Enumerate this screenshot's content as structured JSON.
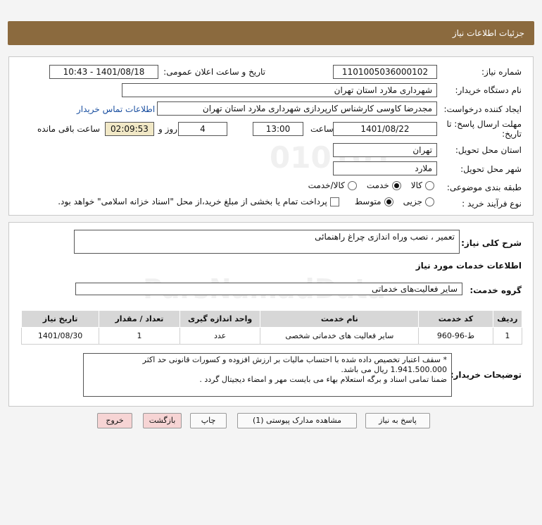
{
  "header": {
    "title": "جزئیات اطلاعات نیاز"
  },
  "form": {
    "need_number": {
      "label": "شماره نیاز:",
      "value": "1101005036000102"
    },
    "announce": {
      "label": "تاریخ و ساعت اعلان عمومی:",
      "value": "1401/08/18 - 10:43"
    },
    "buyer": {
      "label": "نام دستگاه خریدار:",
      "value": "شهرداری ملارد استان تهران"
    },
    "creator": {
      "label": "ایجاد کننده درخواست:",
      "value": "مجدرضا کاوسی کارشناس کارپردازی شهرداری ملارد استان تهران",
      "contact_link": "اطلاعات تماس خریدار"
    },
    "deadline": {
      "label_line1": "مهلت ارسال پاسخ: تا",
      "label_line2": "تاریخ:",
      "date": "1401/08/22",
      "time_label": "ساعت",
      "time": "13:00",
      "days": "4",
      "days_label": "روز و",
      "remaining": "02:09:53",
      "remaining_label": "ساعت باقی مانده"
    },
    "province": {
      "label": "استان محل تحویل:",
      "value": "تهران"
    },
    "city": {
      "label": "شهر محل تحویل:",
      "value": "ملارد"
    },
    "category": {
      "label": "طبقه بندی موضوعی:",
      "options": [
        "کالا",
        "خدمت",
        "کالا/خدمت"
      ],
      "selected": "خدمت"
    },
    "process": {
      "label": "نوع فرآیند خرید :",
      "options": [
        "جزیی",
        "متوسط"
      ],
      "selected": "متوسط",
      "payment_note": "پرداخت تمام یا بخشی از مبلغ خرید،از محل \"اسناد خزانه اسلامی\" خواهد بود."
    }
  },
  "details": {
    "summary_label": "شرح کلی نیاز:",
    "summary": "تعمیر ، نصب وراه اندازی چراغ راهنمائی",
    "services_title": "اطلاعات خدمات مورد نیاز",
    "service_group_label": "گروه خدمت:",
    "service_group": "سایر فعالیت‌های خدماتی",
    "table": {
      "headers": [
        "ردیف",
        "کد خدمت",
        "نام خدمت",
        "واحد اندازه گیری",
        "تعداد / مقدار",
        "تاریخ نیاز"
      ],
      "rows": [
        [
          "1",
          "ط-96-960",
          "سایر فعالیت های خدماتی شخصی",
          "عدد",
          "1",
          "1401/08/30"
        ]
      ]
    },
    "buyer_notes_label": "توضیحات خریدار:",
    "buyer_notes": [
      "* سقف اعتبار تخصیص داده شده با احتساب مالیات بر ارزش افزوده و کسورات قانونی حد اکثر",
      "1.941.500.000 ریال می باشد.",
      "ضمنا تمامی اسناد و برگه استعلام بهاء می بایست مهر و امضاء دیجیتال گردد ."
    ]
  },
  "buttons": {
    "reply": "پاسخ به نیاز",
    "view_docs": "مشاهده مدارک پیوستی (1)",
    "print": "چاپ",
    "back": "بازگشت",
    "exit": "خروج"
  },
  "watermark": {
    "brand": "ParsNamadData"
  }
}
